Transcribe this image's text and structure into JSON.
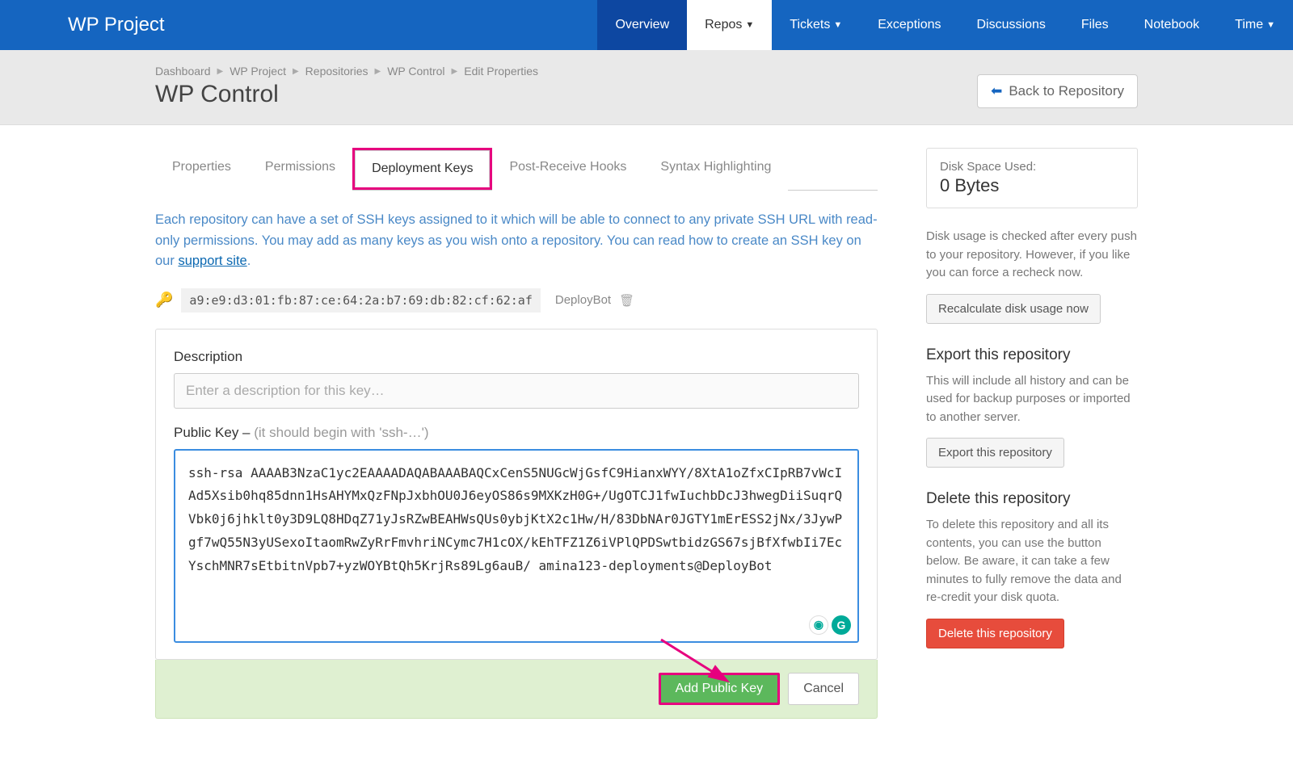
{
  "brand": "WP Project",
  "nav": {
    "overview": "Overview",
    "repos": "Repos",
    "tickets": "Tickets",
    "exceptions": "Exceptions",
    "discussions": "Discussions",
    "files": "Files",
    "notebook": "Notebook",
    "time": "Time"
  },
  "breadcrumbs": {
    "items": [
      "Dashboard",
      "WP Project",
      "Repositories",
      "WP Control",
      "Edit Properties"
    ]
  },
  "page_title": "WP Control",
  "back_button": "Back to Repository",
  "tabs": {
    "properties": "Properties",
    "permissions": "Permissions",
    "deployment_keys": "Deployment Keys",
    "post_receive_hooks": "Post-Receive Hooks",
    "syntax_highlighting": "Syntax Highlighting"
  },
  "intro": {
    "text_before_link": "Each repository can have a set of SSH keys assigned to it which will be able to connect to any private SSH URL with read-only permissions. You may add as many keys as you wish onto a repository. You can read how to create an SSH key on our ",
    "link_text": "support site",
    "text_after_link": "."
  },
  "existing_key": {
    "fingerprint": "a9:e9:d3:01:fb:87:ce:64:2a:b7:69:db:82:cf:62:af",
    "name": "DeployBot"
  },
  "form": {
    "description_label": "Description",
    "description_placeholder": "Enter a description for this key…",
    "public_key_label": "Public Key – ",
    "public_key_hint": "(it should begin with 'ssh-…')",
    "public_key_value": "ssh-rsa AAAAB3NzaC1yc2EAAAADAQABAAABAQCxCenS5NUGcWjGsfC9HianxWYY/8XtA1oZfxCIpRB7vWcIAd5Xsib0hq85dnn1HsAHYMxQzFNpJxbhOU0J6eyOS86s9MXKzH0G+/UgOTCJ1fwIuchbDcJ3hwegDiiSuqrQVbk0j6jhklt0y3D9LQ8HDqZ71yJsRZwBEAHWsQUs0ybjKtX2c1Hw/H/83DbNAr0JGTY1mErESS2jNx/3JywPgf7wQ55N3yUSexoItaomRwZyRrFmvhriNCymc7H1cOX/kEhTFZ1Z6iVPlQPDSwtbidzGS67sjBfXfwbIi7EcYschMNR7sEtbitnVpb7+yzWOYBtQh5KrjRs89Lg6auB/ amina123-deployments@DeployBot",
    "submit": "Add Public Key",
    "cancel": "Cancel"
  },
  "sidebar": {
    "disk": {
      "label": "Disk Space Used:",
      "value": "0 Bytes",
      "note": "Disk usage is checked after every push to your repository. However, if you like you can force a recheck now.",
      "button": "Recalculate disk usage now"
    },
    "export": {
      "heading": "Export this repository",
      "note": "This will include all history and can be used for backup purposes or imported to another server.",
      "button": "Export this repository"
    },
    "delete": {
      "heading": "Delete this repository",
      "note": "To delete this repository and all its contents, you can use the button below. Be aware, it can take a few minutes to fully remove the data and re-credit your disk quota.",
      "button": "Delete this repository"
    }
  }
}
